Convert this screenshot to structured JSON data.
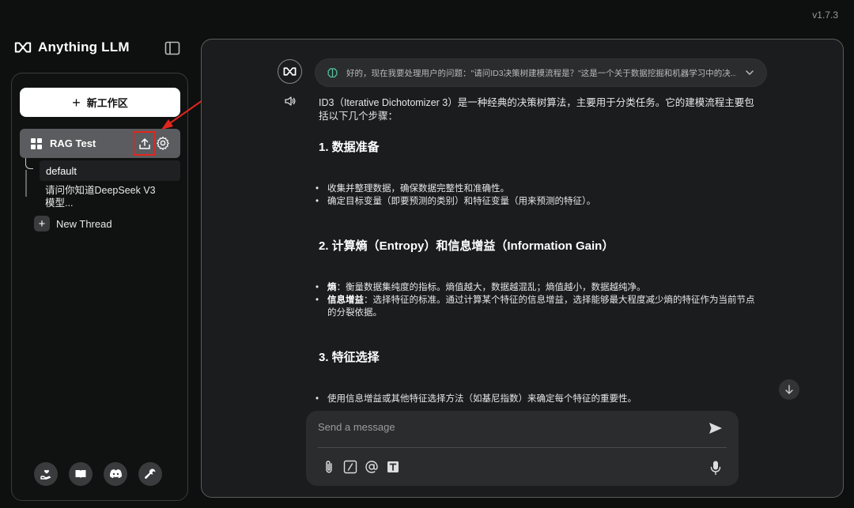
{
  "app": {
    "version": "v1.7.3",
    "brand": "Anything LLM"
  },
  "sidebar": {
    "new_workspace_label": "新工作区",
    "workspace": {
      "name": "RAG Test"
    },
    "threads": [
      {
        "label": "default"
      },
      {
        "label": "请问你知道DeepSeek V3模型..."
      }
    ],
    "new_thread_label": "New Thread"
  },
  "chat": {
    "thought": "好的，现在我要处理用户的问题：\"请问ID3决策树建模流程是？\"这是一个关于数据挖掘和机器学习中的决...",
    "intro": "ID3（Iterative Dichotomizer 3）是一种经典的决策树算法，主要用于分类任务。它的建模流程主要包括以下几个步骤：",
    "sections": [
      {
        "heading": "1. 数据准备",
        "items": [
          {
            "bold": "",
            "text": "收集并整理数据，确保数据完整性和准确性。"
          },
          {
            "bold": "",
            "text": "确定目标变量（即要预测的类别）和特征变量（用来预测的特征）。"
          }
        ]
      },
      {
        "heading": "2. 计算熵（Entropy）和信息增益（Information Gain）",
        "items": [
          {
            "bold": "熵",
            "text": "：衡量数据集纯度的指标。熵值越大，数据越混乱；熵值越小，数据越纯净。"
          },
          {
            "bold": "信息增益",
            "text": "：选择特征的标准。通过计算某个特征的信息增益，选择能够最大程度减少熵的特征作为当前节点的分裂依据。"
          }
        ]
      },
      {
        "heading": "3. 特征选择",
        "items": [
          {
            "bold": "",
            "text": "使用信息增益或其他特征选择方法（如基尼指数）来确定每个特征的重要性。"
          }
        ]
      }
    ]
  },
  "composer": {
    "placeholder": "Send a message"
  },
  "colors": {
    "highlight_red": "#e3261d",
    "workspace_bg": "#5a5c5f"
  }
}
